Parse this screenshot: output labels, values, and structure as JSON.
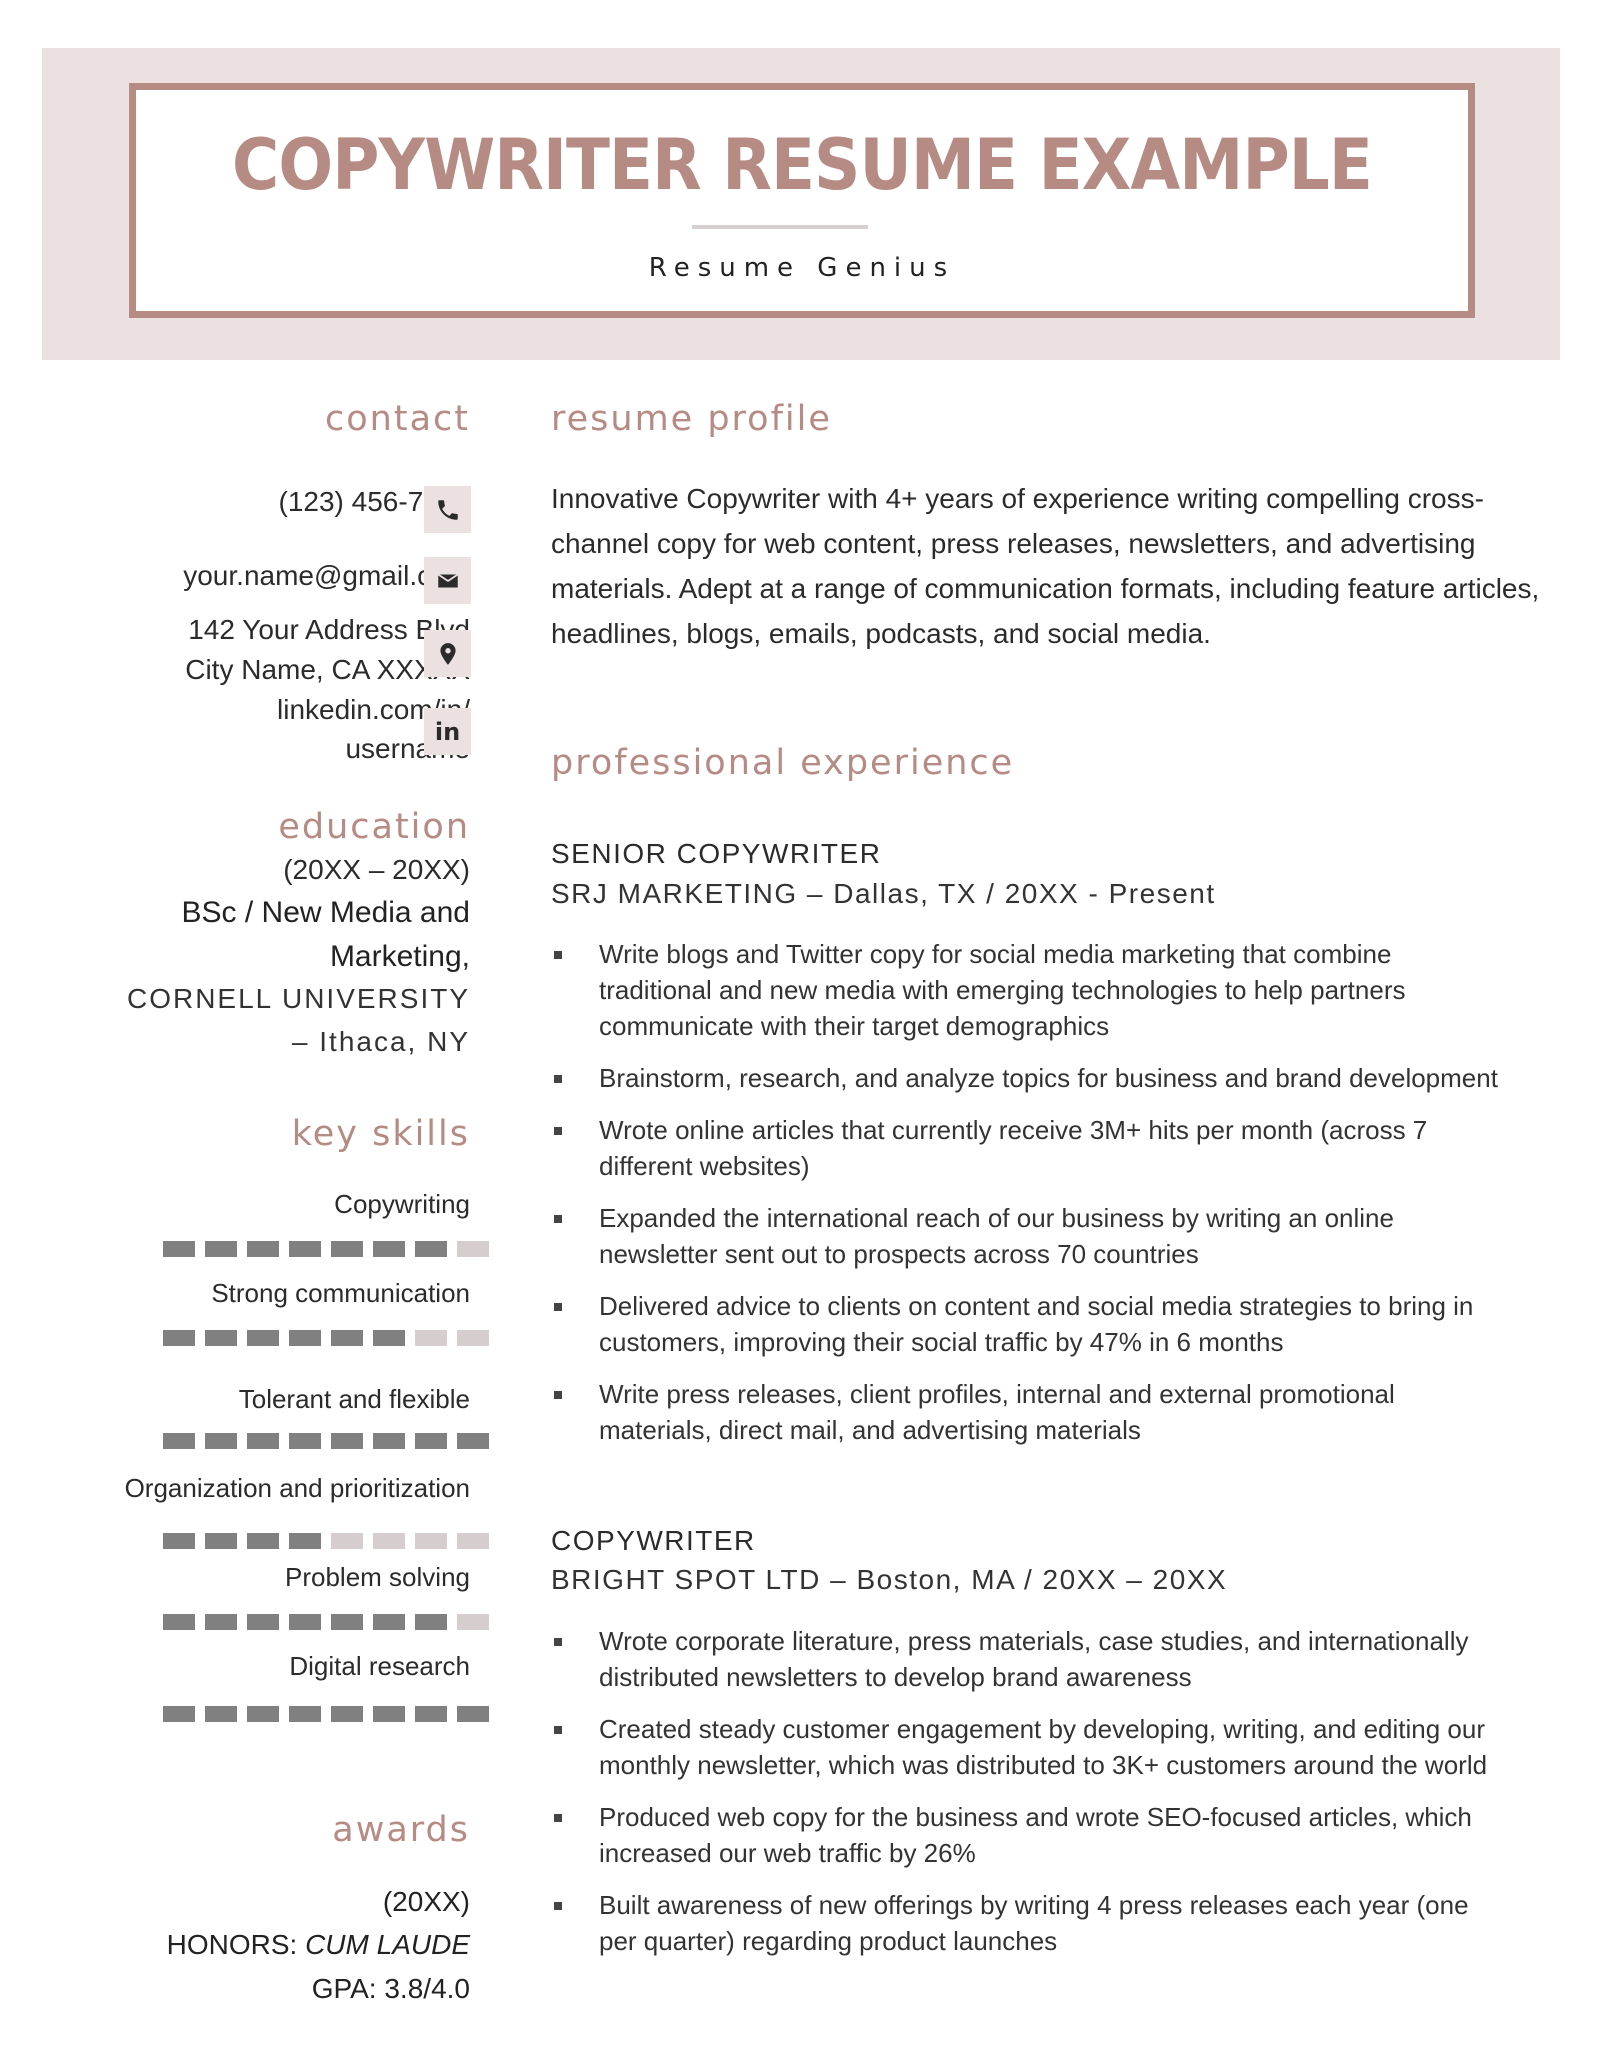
{
  "header": {
    "title": "COPYWRITER RESUME EXAMPLE",
    "subtitle": "Resume Genius"
  },
  "colors": {
    "accent": "#b58b84",
    "band": "#ebe1e0",
    "skill_filled": "#808080",
    "skill_empty": "#d6cece",
    "text": "#2b2b2b"
  },
  "contact": {
    "heading": "contact",
    "phone": "(123) 456-7895",
    "email": "your.name@gmail.com",
    "address_line1": "142 Your Address Blvd",
    "address_line2": "City Name, CA XXXXX",
    "linkedin_line1": "linkedin.com/in/",
    "linkedin_line2": "username",
    "icons": [
      "phone-icon",
      "email-icon",
      "location-pin-icon",
      "linkedin-icon"
    ],
    "linkedin_glyph": "in"
  },
  "education": {
    "heading": "education",
    "dates": "(20XX – 20XX)",
    "degree_line1": "BSc / New Media and",
    "degree_line2": "Marketing,",
    "school": "CORNELL UNIVERSITY",
    "location": "–  Ithaca, NY"
  },
  "skills": {
    "heading": "key skills",
    "max_level": 8,
    "items": [
      {
        "name": "Copywriting",
        "level": 7
      },
      {
        "name": "Strong communication",
        "level": 6
      },
      {
        "name": "Tolerant and flexible",
        "level": 8
      },
      {
        "name": "Organization and prioritization",
        "level": 4
      },
      {
        "name": "Problem solving",
        "level": 7
      },
      {
        "name": "Digital research",
        "level": 8
      }
    ]
  },
  "awards": {
    "heading": "awards",
    "year": "(20XX)",
    "honors_label": "HONORS: ",
    "honors_value": "CUM LAUDE",
    "gpa": "GPA: 3.8/4.0"
  },
  "profile": {
    "heading": "resume profile",
    "text": "Innovative Copywriter with 4+ years of experience writing compelling cross-channel copy for web content, press releases, newsletters, and advertising materials. Adept at a range of communication formats, including feature articles, headlines, blogs, emails, podcasts, and social media."
  },
  "experience": {
    "heading": "professional experience",
    "jobs": [
      {
        "title": "SENIOR COPYWRITER",
        "meta": "SRJ MARKETING – Dallas, TX / 20XX - Present",
        "bullets": [
          "Write blogs and Twitter copy for social media marketing that combine traditional and new media with emerging technologies to help partners communicate with their target demographics",
          "Brainstorm, research, and analyze topics for business and brand development",
          "Wrote online articles that currently receive 3M+ hits per month (across 7 different websites)",
          "Expanded the international reach of our business by writing an online newsletter sent out to prospects across 70 countries",
          "Delivered advice to clients on content and social media strategies to bring in customers, improving their social traffic by 47% in 6 months",
          "Write press releases, client profiles, internal and external promotional materials, direct mail, and advertising materials"
        ]
      },
      {
        "title": "COPYWRITER",
        "meta": "BRIGHT SPOT LTD – Boston, MA / 20XX – 20XX",
        "bullets": [
          "Wrote corporate literature, press materials, case studies, and internationally distributed newsletters to develop brand awareness",
          "Created steady customer engagement by developing, writing, and editing our monthly newsletter, which was distributed to 3K+ customers around the world",
          "Produced web copy for the business and wrote SEO-focused articles, which increased our web traffic by 26%",
          "Built awareness of new offerings by writing 4 press releases each year (one per quarter) regarding product launches"
        ]
      }
    ]
  }
}
